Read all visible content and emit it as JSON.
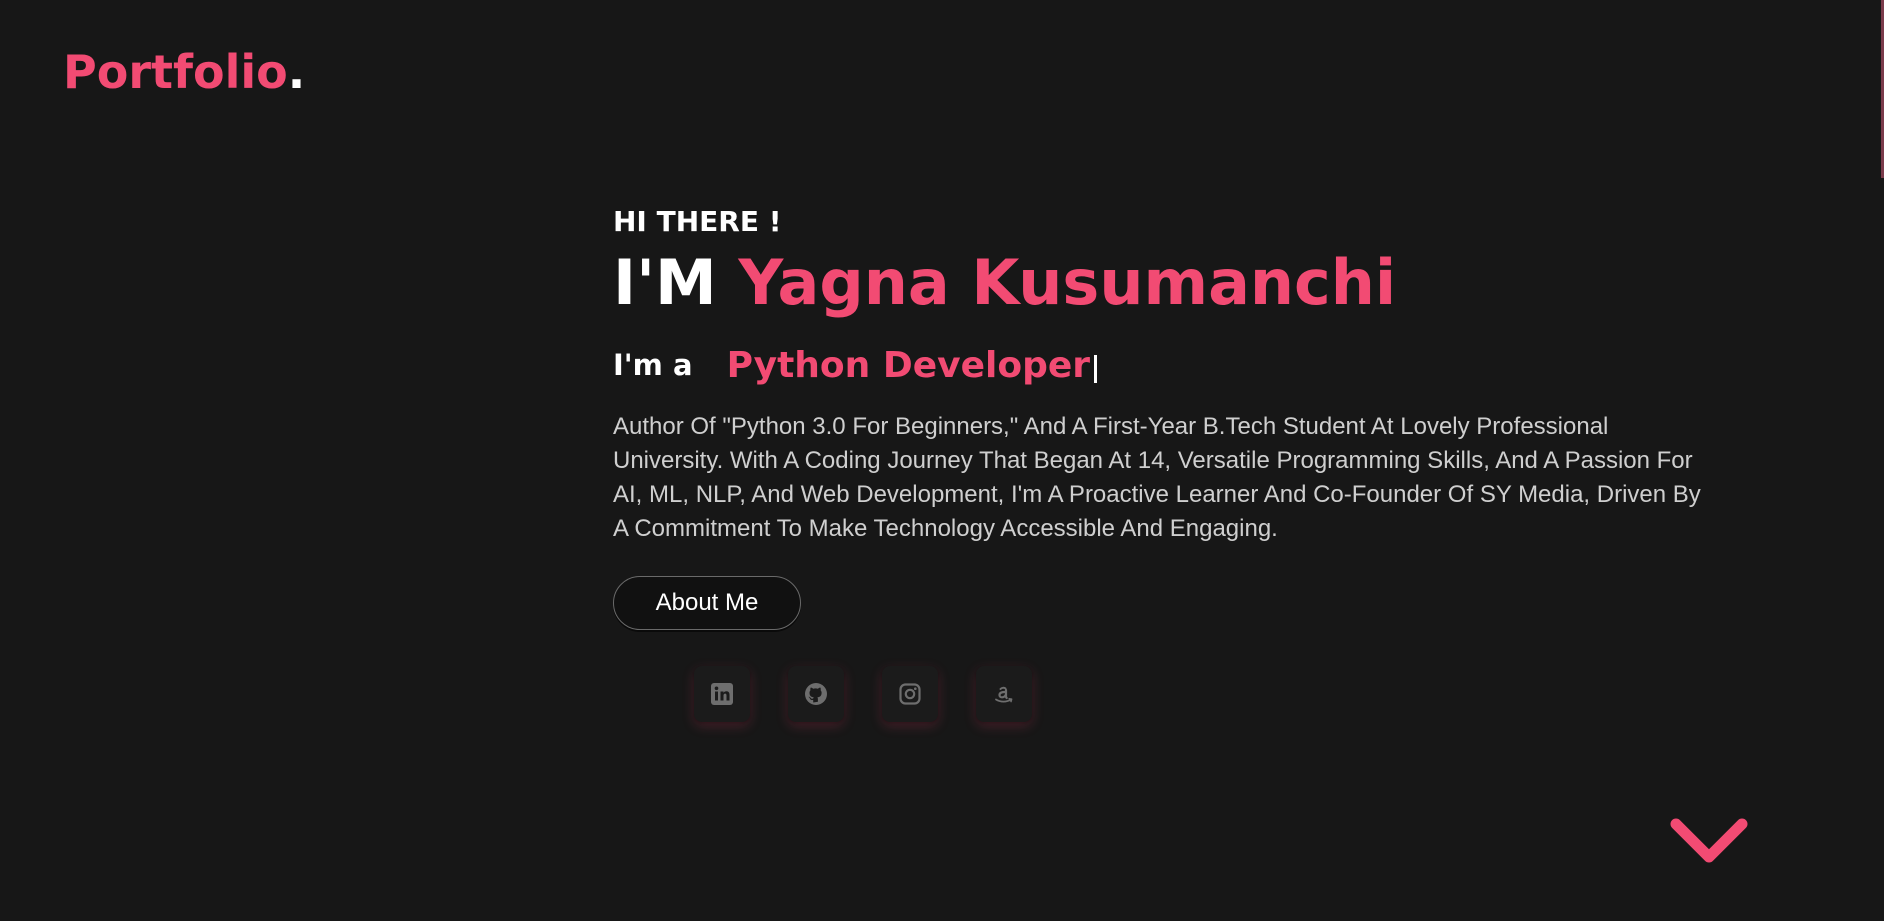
{
  "logo": {
    "text": "Portfolio",
    "dot": "."
  },
  "hero": {
    "greeting": "HI THERE !",
    "prefix": "I'M",
    "name": "Yagna Kusumanchi",
    "role_prefix": "I'm a",
    "role": "Python Developer",
    "bio": "Author Of \"Python 3.0 For Beginners,\" And A First-Year B.Tech Student At Lovely Professional University. With A Coding Journey That Began At 14, Versatile Programming Skills, And A Passion For AI, ML, NLP, And Web Development, I'm A Proactive Learner And Co-Founder Of SY Media, Driven By A Commitment To Make Technology Accessible And Engaging.",
    "button_label": "About Me"
  },
  "socials": [
    {
      "icon": "linkedin-icon"
    },
    {
      "icon": "github-icon"
    },
    {
      "icon": "instagram-icon"
    },
    {
      "icon": "amazon-icon"
    }
  ],
  "scroll_down": {
    "icon": "chevron-down-icon"
  },
  "colors": {
    "background": "#171717",
    "accent": "#f24b73",
    "text": "#ffffff",
    "muted_text": "#cfcfcf",
    "icon": "#6e6e6e"
  }
}
